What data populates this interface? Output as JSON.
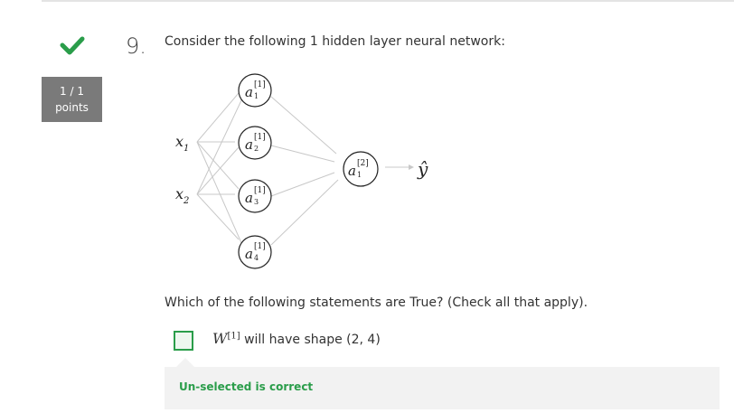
{
  "status": {
    "score": "1 / 1",
    "score_unit": "points",
    "correct_color": "#2a9d4a"
  },
  "question": {
    "number": "9.",
    "prompt": "Consider the following 1 hidden layer neural network:",
    "statement": "Which of the following statements are True? (Check all that apply).",
    "diagram": {
      "inputs": [
        {
          "var": "x",
          "sub": "1"
        },
        {
          "var": "x",
          "sub": "2"
        }
      ],
      "hidden": [
        {
          "var": "a",
          "sup": "[1]",
          "sub": "1"
        },
        {
          "var": "a",
          "sup": "[1]",
          "sub": "2"
        },
        {
          "var": "a",
          "sup": "[1]",
          "sub": "3"
        },
        {
          "var": "a",
          "sup": "[1]",
          "sub": "4"
        }
      ],
      "output": {
        "var": "a",
        "sup": "[2]",
        "sub": "1"
      },
      "prediction": "ŷ"
    },
    "option": {
      "math_var": "W",
      "math_sup": "[1]",
      "text": "will have shape (2, 4)",
      "checked": false
    },
    "feedback": "Un-selected is correct"
  }
}
